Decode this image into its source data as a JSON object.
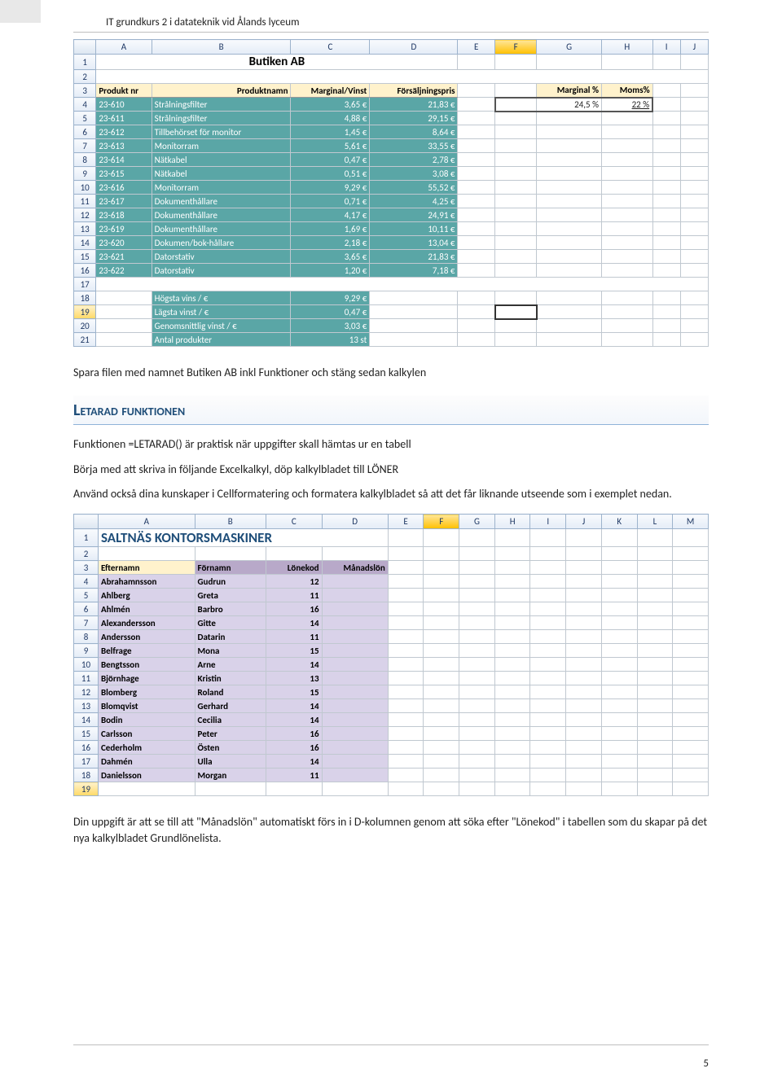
{
  "header": "IT grundkurs 2 i datateknik vid Ålands lyceum",
  "pagenum": "5",
  "sheet1": {
    "cols": [
      "A",
      "B",
      "C",
      "D",
      "E",
      "F",
      "G",
      "H",
      "I",
      "J"
    ],
    "title": "Butiken AB",
    "headers": [
      "Produkt nr",
      "Produktnamn",
      "Marginal/Vinst",
      "Försäljningspris",
      "",
      "",
      "Marginal %",
      "Moms%"
    ],
    "percents": {
      "marginal": "24,5 %",
      "moms": "22 %"
    },
    "rows": [
      {
        "n": "4",
        "a": "23-610",
        "b": "Strålningsfilter",
        "c": "3,65 €",
        "d": "21,83 €"
      },
      {
        "n": "5",
        "a": "23-611",
        "b": "Strålningsfilter",
        "c": "4,88 €",
        "d": "29,15 €"
      },
      {
        "n": "6",
        "a": "23-612",
        "b": "Tillbehörset för monitor",
        "c": "1,45 €",
        "d": "8,64 €"
      },
      {
        "n": "7",
        "a": "23-613",
        "b": "Monitorram",
        "c": "5,61 €",
        "d": "33,55 €"
      },
      {
        "n": "8",
        "a": "23-614",
        "b": "Nätkabel",
        "c": "0,47 €",
        "d": "2,78 €"
      },
      {
        "n": "9",
        "a": "23-615",
        "b": "Nätkabel",
        "c": "0,51 €",
        "d": "3,08 €"
      },
      {
        "n": "10",
        "a": "23-616",
        "b": "Monitorram",
        "c": "9,29 €",
        "d": "55,52 €"
      },
      {
        "n": "11",
        "a": "23-617",
        "b": "Dokumenthållare",
        "c": "0,71 €",
        "d": "4,25 €"
      },
      {
        "n": "12",
        "a": "23-618",
        "b": "Dokumenthållare",
        "c": "4,17 €",
        "d": "24,91 €"
      },
      {
        "n": "13",
        "a": "23-619",
        "b": "Dokumenthållare",
        "c": "1,69 €",
        "d": "10,11 €"
      },
      {
        "n": "14",
        "a": "23-620",
        "b": "Dokumen/bok-hållare",
        "c": "2,18 €",
        "d": "13,04 €"
      },
      {
        "n": "15",
        "a": "23-621",
        "b": "Datorstativ",
        "c": "3,65 €",
        "d": "21,83 €"
      },
      {
        "n": "16",
        "a": "23-622",
        "b": "Datorstativ",
        "c": "1,20 €",
        "d": "7,18 €"
      }
    ],
    "summary": [
      {
        "n": "18",
        "label": "Högsta vins / €",
        "val": "9,29 €"
      },
      {
        "n": "19",
        "label": "Lägsta vinst / €",
        "val": "0,47 €"
      },
      {
        "n": "20",
        "label": "Genomsnittlig vinst / €",
        "val": "3,03 €"
      },
      {
        "n": "21",
        "label": "Antal produkter",
        "val": "13 st"
      }
    ]
  },
  "body": {
    "p1": "Spara filen med namnet Butiken AB inkl Funktioner och stäng sedan kalkylen",
    "h2": "Letarad funktionen",
    "p2": "Funktionen =LETARAD() är praktisk när uppgifter skall hämtas ur en tabell",
    "p3": "Börja med att skriva in följande Excelkalkyl, döp kalkylbladet till LÖNER",
    "p4": "Använd också dina kunskaper i Cellformatering och formatera kalkylbladet så att det får liknande utseende som i exemplet nedan.",
    "p5": "Din uppgift är att se till att \"Månadslön\" automatiskt förs in i D-kolumnen genom att söka efter \"Lönekod\" i tabellen som du skapar på det nya kalkylbladet Grundlönelista."
  },
  "sheet2": {
    "cols": [
      "A",
      "B",
      "C",
      "D",
      "E",
      "F",
      "G",
      "H",
      "I",
      "J",
      "K",
      "L",
      "M"
    ],
    "title": "SALTNÄS KONTORSMASKINER",
    "headers": [
      "Efternamn",
      "Förnamn",
      "Lönekod",
      "Månadslön"
    ],
    "rows": [
      {
        "n": "4",
        "a": "Abrahamnsson",
        "b": "Gudrun",
        "c": "12"
      },
      {
        "n": "5",
        "a": "Ahlberg",
        "b": "Greta",
        "c": "11"
      },
      {
        "n": "6",
        "a": "Ahlmén",
        "b": "Barbro",
        "c": "16"
      },
      {
        "n": "7",
        "a": "Alexandersson",
        "b": "Gitte",
        "c": "14"
      },
      {
        "n": "8",
        "a": "Andersson",
        "b": "Datarin",
        "c": "11"
      },
      {
        "n": "9",
        "a": "Belfrage",
        "b": "Mona",
        "c": "15"
      },
      {
        "n": "10",
        "a": "Bengtsson",
        "b": "Arne",
        "c": "14"
      },
      {
        "n": "11",
        "a": "Björnhage",
        "b": "Kristin",
        "c": "13"
      },
      {
        "n": "12",
        "a": "Blomberg",
        "b": "Roland",
        "c": "15"
      },
      {
        "n": "13",
        "a": "Blomqvist",
        "b": "Gerhard",
        "c": "14"
      },
      {
        "n": "14",
        "a": "Bodin",
        "b": "Cecilia",
        "c": "14"
      },
      {
        "n": "15",
        "a": "Carlsson",
        "b": "Peter",
        "c": "16"
      },
      {
        "n": "16",
        "a": "Cederholm",
        "b": "Östen",
        "c": "16"
      },
      {
        "n": "17",
        "a": "Dahmén",
        "b": "Ulla",
        "c": "14"
      },
      {
        "n": "18",
        "a": "Danielsson",
        "b": "Morgan",
        "c": "11"
      }
    ]
  }
}
